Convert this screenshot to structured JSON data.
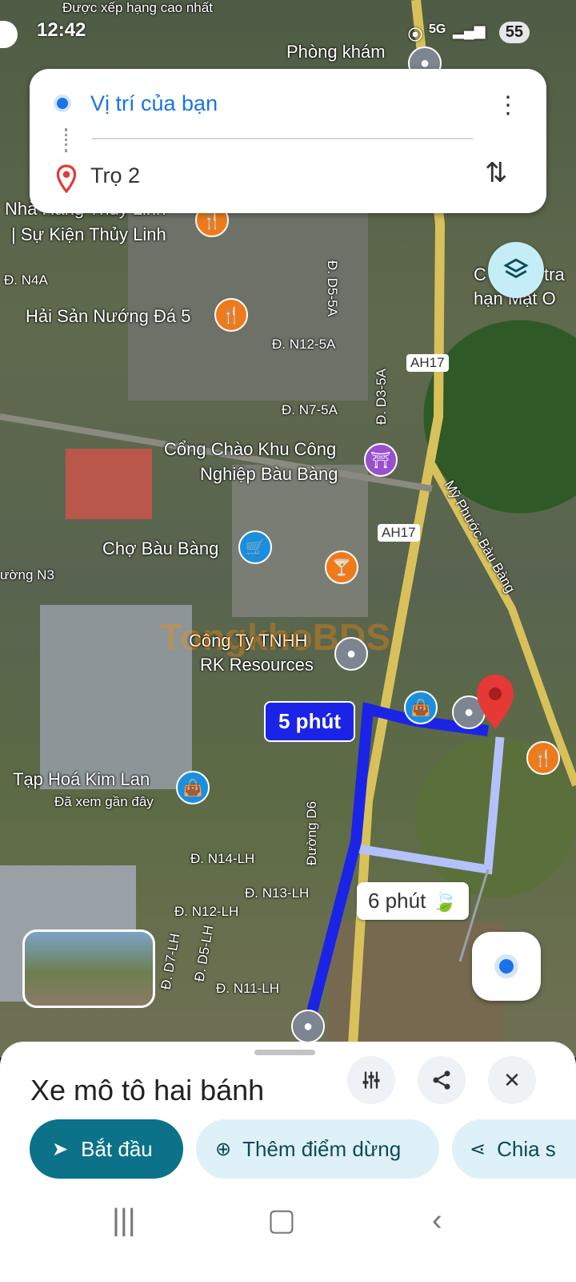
{
  "status_bar": {
    "time": "12:42",
    "network": "5G",
    "battery": "55"
  },
  "top_card": {
    "origin": "Vị trí của bạn",
    "destination": "Trọ 2",
    "menu_icon": "more-vert-icon",
    "swap_icon": "swap-vert-icon"
  },
  "map": {
    "labels": [
      "Được xếp hạng cao nhất",
      "Phòng khám",
      "Nhà Hàng Thủy Linh",
      "| Sự Kiện Thủy Linh",
      "Đ. N4A",
      "Hải Sản Nướng Đá 5",
      "Đ. N12-5A",
      "Đ. D5-5A",
      "AH17",
      "Đ. N7-5A",
      "Đ. D3-5A",
      "Cổng Chào Khu Công",
      "Nghiệp Bàu Bàng",
      "Mỹ Phước Bàu Bàng",
      "AH17",
      "Chợ Bàu Bàng",
      "ường N3",
      "Công Ty TNHH",
      "RK Resources",
      "Tạp Hoá Kim Lan",
      "Đã xem gần đây",
      "Đ. N14-LH",
      "Đường D6",
      "Đ. N13-LH",
      "Đ. N12-LH",
      "Đ. D7-LH",
      "Đ. D5-LH",
      "Đ. N11-LH",
      "C",
      "tra",
      "hạn Mặt O"
    ],
    "route_primary_time": "5 phút",
    "route_alt_time": "6 phút",
    "watermark": "TongkhoBDS",
    "accent_route": "#1b24e6",
    "accent_alt_route": "#b4c1ff"
  },
  "bottom_sheet": {
    "mode_title": "Xe mô tô hai bánh",
    "filter_icon": "tune-icon",
    "share_icon": "share-icon",
    "close_icon": "close-icon",
    "start_label": "Bắt đầu",
    "add_stop_label": "Thêm điểm dừng",
    "share_label": "Chia s",
    "start_color": "#0b7289",
    "pill_color": "#dff1f8"
  },
  "nav_bar": {
    "recent_icon": "recent-apps-icon",
    "home_icon": "home-icon",
    "back_icon": "back-icon"
  }
}
